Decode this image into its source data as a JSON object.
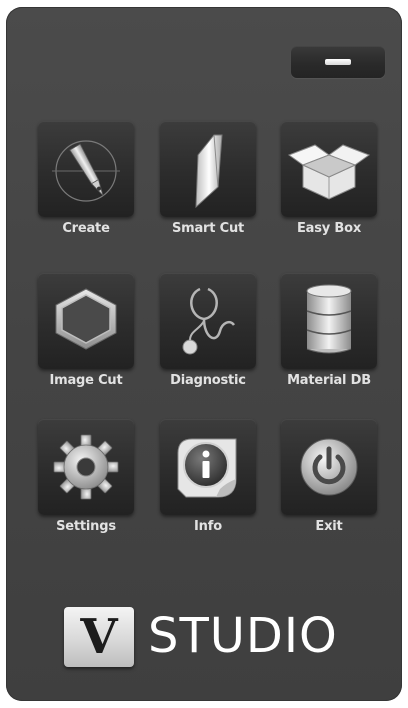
{
  "window": {
    "minimize_icon": "minimize-icon"
  },
  "menu": {
    "tiles": [
      {
        "label": "Create",
        "icon": "pen-tool-icon"
      },
      {
        "label": "Smart Cut",
        "icon": "blade-icon"
      },
      {
        "label": "Easy Box",
        "icon": "box-icon"
      },
      {
        "label": "Image Cut",
        "icon": "hexagon-icon"
      },
      {
        "label": "Diagnostic",
        "icon": "stethoscope-icon"
      },
      {
        "label": "Material DB",
        "icon": "database-icon"
      },
      {
        "label": "Settings",
        "icon": "gear-icon"
      },
      {
        "label": "Info",
        "icon": "info-icon"
      },
      {
        "label": "Exit",
        "icon": "power-icon"
      }
    ]
  },
  "logo": {
    "badge_letter": "V",
    "wordmark": "STUDIO"
  },
  "colors": {
    "panel": "#454545",
    "tile": "#2c2c2c",
    "label": "#e2e2e2",
    "accent": "#ffffff"
  }
}
